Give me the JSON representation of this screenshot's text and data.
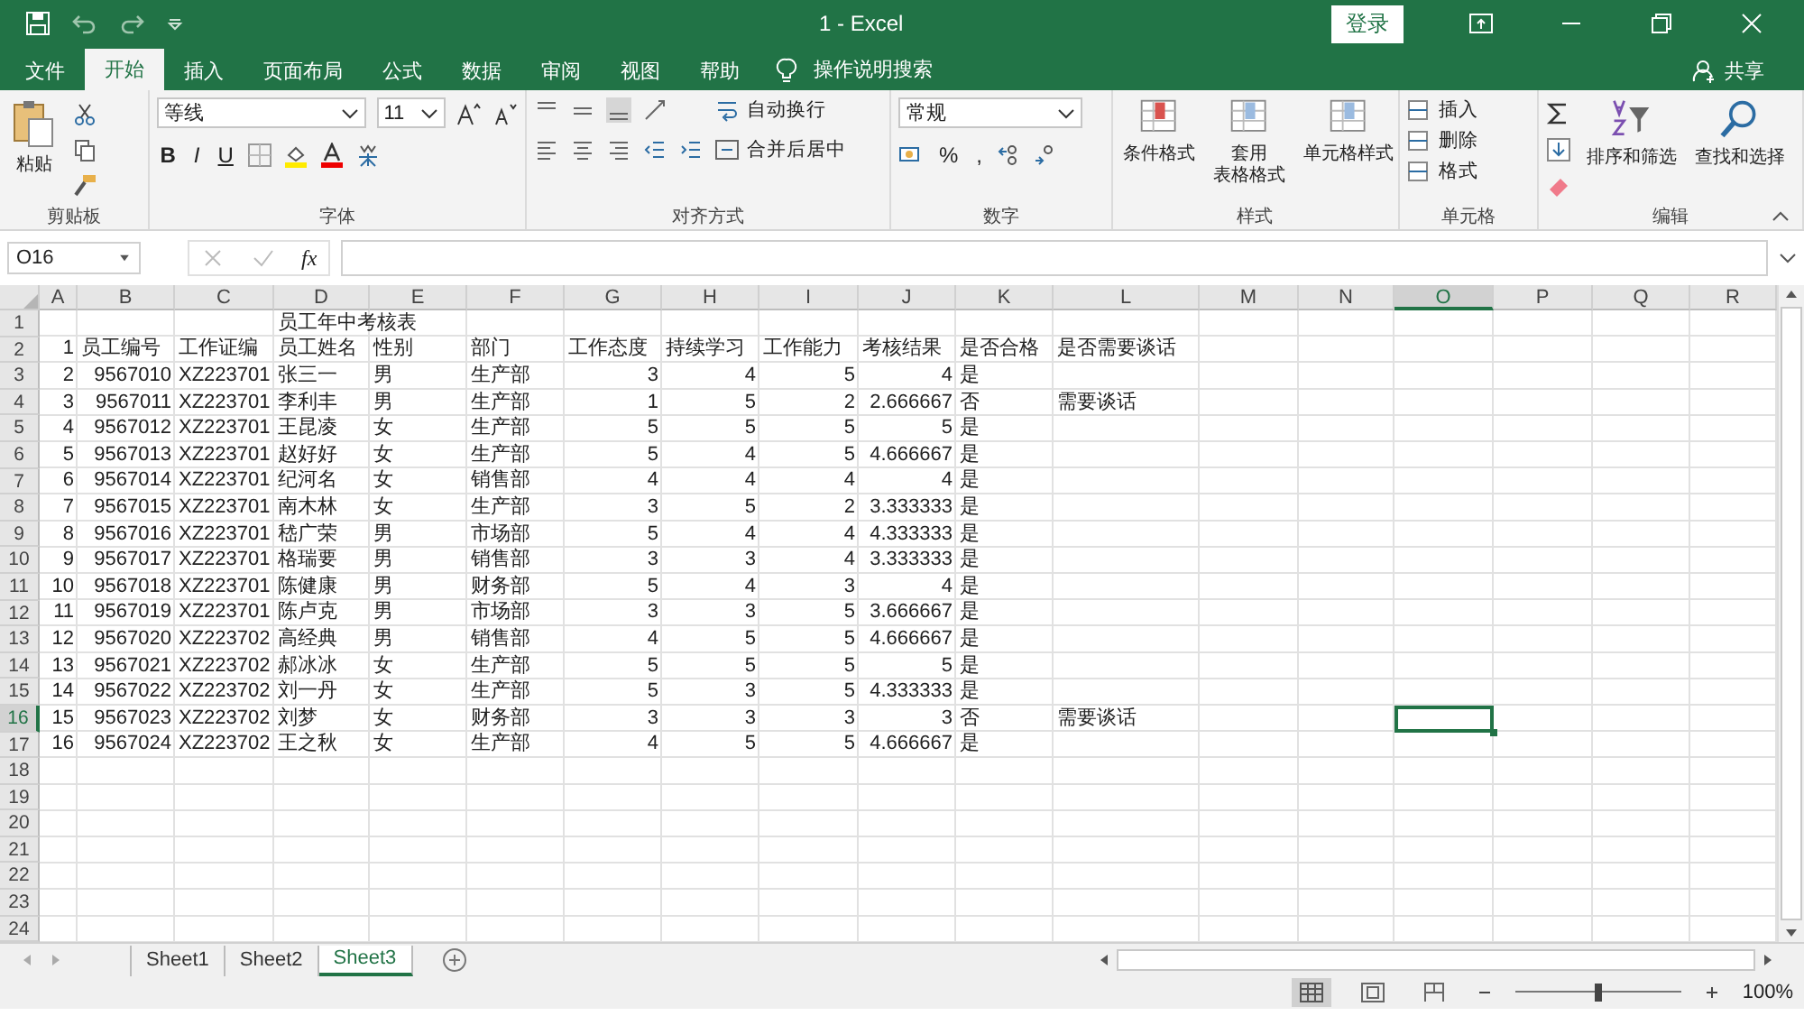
{
  "title_bar": {
    "title": "1  -  Excel",
    "login_button": "登录"
  },
  "menu_tabs": [
    {
      "label": "文件",
      "selected": false
    },
    {
      "label": "开始",
      "selected": true
    },
    {
      "label": "插入",
      "selected": false
    },
    {
      "label": "页面布局",
      "selected": false
    },
    {
      "label": "公式",
      "selected": false
    },
    {
      "label": "数据",
      "selected": false
    },
    {
      "label": "审阅",
      "selected": false
    },
    {
      "label": "视图",
      "selected": false
    },
    {
      "label": "帮助",
      "selected": false
    }
  ],
  "tell_me": {
    "placeholder": "操作说明搜索"
  },
  "share_button": "共享",
  "ribbon": {
    "clipboard": {
      "paste": "粘贴",
      "label": "剪贴板"
    },
    "font": {
      "name": "等线",
      "size": "11",
      "style_buttons": [
        "B",
        "I",
        "U"
      ],
      "label": "字体"
    },
    "alignment": {
      "wrap": "自动换行",
      "merge": "合并后居中",
      "label": "对齐方式"
    },
    "number": {
      "format": "常规",
      "buttons": [
        "%",
        ","
      ],
      "label": "数字"
    },
    "styles": {
      "buttons": [
        {
          "lines": [
            "条件格式"
          ]
        },
        {
          "lines": [
            "套用",
            "表格格式"
          ]
        },
        {
          "lines": [
            "单元格样式"
          ]
        }
      ],
      "label": "样式"
    },
    "cells": {
      "buttons": [
        "插入",
        "删除",
        "格式"
      ],
      "label": "单元格"
    },
    "editing": {
      "buttons": [
        "排序和筛选",
        "查找和选择"
      ],
      "label": "编辑"
    }
  },
  "formula_bar": {
    "name_box": "O16",
    "fx": "fx"
  },
  "sheet": {
    "columns": [
      {
        "label": "A",
        "selected": false
      },
      {
        "label": "B",
        "selected": false
      },
      {
        "label": "C",
        "selected": false
      },
      {
        "label": "D",
        "selected": false
      },
      {
        "label": "E",
        "selected": false
      },
      {
        "label": "F",
        "selected": false
      },
      {
        "label": "G",
        "selected": false
      },
      {
        "label": "H",
        "selected": false
      },
      {
        "label": "I",
        "selected": false
      },
      {
        "label": "J",
        "selected": false
      },
      {
        "label": "K",
        "selected": false
      },
      {
        "label": "L",
        "selected": false
      },
      {
        "label": "M",
        "selected": false
      },
      {
        "label": "N",
        "selected": false
      },
      {
        "label": "O",
        "selected": true
      },
      {
        "label": "P",
        "selected": false
      },
      {
        "label": "Q",
        "selected": false
      },
      {
        "label": "R",
        "selected": false
      }
    ],
    "rows": [
      {
        "label": "1",
        "selected": false,
        "cells": [
          null,
          null,
          null,
          "员工年中考核表"
        ]
      },
      {
        "label": "2",
        "selected": false,
        "cells": [
          "1",
          "员工编号",
          "工作证编",
          "员工姓名",
          "性别",
          "部门",
          "工作态度",
          "持续学习",
          "工作能力",
          "考核结果",
          "是否合格",
          "是否需要谈话"
        ]
      },
      {
        "label": "3",
        "selected": false,
        "cells": [
          "2",
          "9567010",
          "XZ223701",
          "张三一",
          "男",
          "生产部",
          "3",
          "4",
          "5",
          "4",
          "是"
        ]
      },
      {
        "label": "4",
        "selected": false,
        "cells": [
          "3",
          "9567011",
          "XZ223701",
          "李利丰",
          "男",
          "生产部",
          "1",
          "5",
          "2",
          "2.666667",
          "否",
          "需要谈话"
        ]
      },
      {
        "label": "5",
        "selected": false,
        "cells": [
          "4",
          "9567012",
          "XZ223701",
          "王昆凌",
          "女",
          "生产部",
          "5",
          "5",
          "5",
          "5",
          "是"
        ]
      },
      {
        "label": "6",
        "selected": false,
        "cells": [
          "5",
          "9567013",
          "XZ223701",
          "赵好好",
          "女",
          "生产部",
          "5",
          "4",
          "5",
          "4.666667",
          "是"
        ]
      },
      {
        "label": "7",
        "selected": false,
        "cells": [
          "6",
          "9567014",
          "XZ223701",
          "纪河名",
          "女",
          "销售部",
          "4",
          "4",
          "4",
          "4",
          "是"
        ]
      },
      {
        "label": "8",
        "selected": false,
        "cells": [
          "7",
          "9567015",
          "XZ223701",
          "南木林",
          "女",
          "生产部",
          "3",
          "5",
          "2",
          "3.333333",
          "是"
        ]
      },
      {
        "label": "9",
        "selected": false,
        "cells": [
          "8",
          "9567016",
          "XZ223701",
          "嵇广荣",
          "男",
          "市场部",
          "5",
          "4",
          "4",
          "4.333333",
          "是"
        ]
      },
      {
        "label": "10",
        "selected": false,
        "cells": [
          "9",
          "9567017",
          "XZ223701",
          "格瑞要",
          "男",
          "销售部",
          "3",
          "3",
          "4",
          "3.333333",
          "是"
        ]
      },
      {
        "label": "11",
        "selected": false,
        "cells": [
          "10",
          "9567018",
          "XZ223701",
          "陈健康",
          "男",
          "财务部",
          "5",
          "4",
          "3",
          "4",
          "是"
        ]
      },
      {
        "label": "12",
        "selected": false,
        "cells": [
          "11",
          "9567019",
          "XZ223701",
          "陈卢克",
          "男",
          "市场部",
          "3",
          "3",
          "5",
          "3.666667",
          "是"
        ]
      },
      {
        "label": "13",
        "selected": false,
        "cells": [
          "12",
          "9567020",
          "XZ223702",
          "高经典",
          "男",
          "销售部",
          "4",
          "5",
          "5",
          "4.666667",
          "是"
        ]
      },
      {
        "label": "14",
        "selected": false,
        "cells": [
          "13",
          "9567021",
          "XZ223702",
          "郝冰冰",
          "女",
          "生产部",
          "5",
          "5",
          "5",
          "5",
          "是"
        ]
      },
      {
        "label": "15",
        "selected": false,
        "cells": [
          "14",
          "9567022",
          "XZ223702",
          "刘一丹",
          "女",
          "生产部",
          "5",
          "3",
          "5",
          "4.333333",
          "是"
        ]
      },
      {
        "label": "16",
        "selected": true,
        "cells": [
          "15",
          "9567023",
          "XZ223702",
          "刘梦",
          "女",
          "财务部",
          "3",
          "3",
          "3",
          "3",
          "否",
          "需要谈话"
        ]
      },
      {
        "label": "17",
        "selected": false,
        "cells": [
          "16",
          "9567024",
          "XZ223702",
          "王之秋",
          "女",
          "生产部",
          "4",
          "5",
          "5",
          "4.666667",
          "是"
        ]
      },
      {
        "label": "18",
        "selected": false
      },
      {
        "label": "19",
        "selected": false
      },
      {
        "label": "20",
        "selected": false
      },
      {
        "label": "21",
        "selected": false
      },
      {
        "label": "22",
        "selected": false
      },
      {
        "label": "23",
        "selected": false
      },
      {
        "label": "24",
        "selected": false
      }
    ]
  },
  "sheet_tabs": [
    {
      "label": "Sheet1",
      "selected": false
    },
    {
      "label": "Sheet2",
      "selected": false
    },
    {
      "label": "Sheet3",
      "selected": true
    }
  ],
  "status_bar": {
    "zoom": {
      "level": 0.5,
      "reading": "100%"
    }
  }
}
